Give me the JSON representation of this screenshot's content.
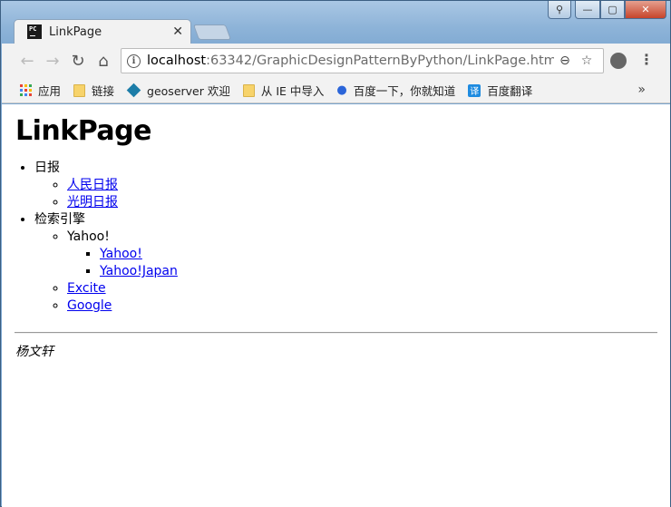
{
  "window": {
    "controls": {
      "user": "⚲",
      "minimize": "—",
      "maximize": "▢",
      "close": "✕"
    }
  },
  "tab": {
    "favicon": "PC",
    "title": "LinkPage",
    "close": "✕"
  },
  "toolbar": {
    "back": "←",
    "forward": "→",
    "reload": "↻",
    "home": "⌂",
    "info": "i",
    "url_host": "localhost",
    "url_rest": ":63342/GraphicDesignPatternByPython/LinkPage.html?_...",
    "zoom": "⊖",
    "star": "☆",
    "menu": "⋮"
  },
  "bookmarks": {
    "items": [
      {
        "label": "应用"
      },
      {
        "label": "链接"
      },
      {
        "label": "geoserver 欢迎"
      },
      {
        "label": "从 IE 中导入"
      },
      {
        "label": "百度一下，你就知道"
      },
      {
        "label": "百度翻译"
      }
    ],
    "translate_glyph": "译",
    "more": "»",
    "apps_colors": [
      "#e84335",
      "#fbbc05",
      "#34a853",
      "#4285f4",
      "#e84335",
      "#fbbc05",
      "#34a853",
      "#4285f4",
      "#e84335"
    ]
  },
  "page": {
    "heading": "LinkPage",
    "sections": [
      {
        "label": "日报",
        "links": [
          "人民日报",
          "光明日报"
        ]
      },
      {
        "label": "检索引擎",
        "sub_label": "Yahoo!",
        "sub_links": [
          "Yahoo!",
          "Yahoo!Japan"
        ],
        "links": [
          "Excite",
          "Google"
        ]
      }
    ],
    "author": "杨文轩"
  }
}
